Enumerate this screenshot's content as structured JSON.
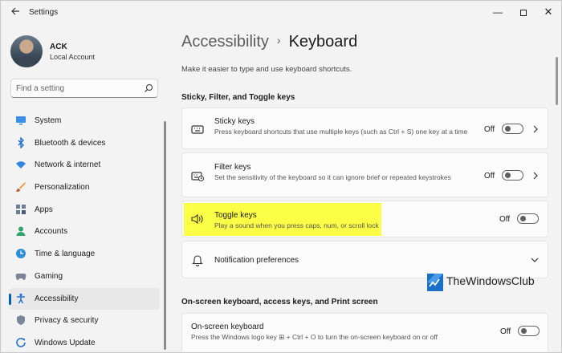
{
  "window": {
    "title": "Settings",
    "controls": {
      "minimize": "—",
      "close": "✕"
    }
  },
  "profile": {
    "name": "ACK",
    "account_type": "Local Account"
  },
  "search": {
    "placeholder": "Find a setting"
  },
  "sidebar": {
    "items": [
      {
        "label": "System",
        "icon": "monitor-icon",
        "active": false
      },
      {
        "label": "Bluetooth & devices",
        "icon": "bluetooth-icon",
        "active": false
      },
      {
        "label": "Network & internet",
        "icon": "wifi-icon",
        "active": false
      },
      {
        "label": "Personalization",
        "icon": "brush-icon",
        "active": false
      },
      {
        "label": "Apps",
        "icon": "apps-icon",
        "active": false
      },
      {
        "label": "Accounts",
        "icon": "person-icon",
        "active": false
      },
      {
        "label": "Time & language",
        "icon": "globe-clock-icon",
        "active": false
      },
      {
        "label": "Gaming",
        "icon": "gamepad-icon",
        "active": false
      },
      {
        "label": "Accessibility",
        "icon": "accessibility-icon",
        "active": true
      },
      {
        "label": "Privacy & security",
        "icon": "shield-icon",
        "active": false
      },
      {
        "label": "Windows Update",
        "icon": "update-icon",
        "active": false
      }
    ]
  },
  "breadcrumb": {
    "parent": "Accessibility",
    "separator": "›",
    "current": "Keyboard"
  },
  "page_description": "Make it easier to type and use keyboard shortcuts.",
  "sections": {
    "sticky_filter_toggle": {
      "title": "Sticky, Filter, and Toggle keys",
      "cards": {
        "sticky": {
          "title": "Sticky keys",
          "description": "Press keyboard shortcuts that use multiple keys (such as Ctrl + S) one key at a time",
          "state": "Off",
          "icon": "keyboard-icon"
        },
        "filter": {
          "title": "Filter keys",
          "description": "Set the sensitivity of the keyboard so it can ignore brief or repeated keystrokes",
          "state": "Off",
          "icon": "keyboard-timer-icon"
        },
        "toggle": {
          "title": "Toggle keys",
          "description": "Play a sound when you press caps, num, or scroll lock",
          "state": "Off",
          "icon": "speaker-icon",
          "highlight_color": "#fbff45"
        },
        "notification": {
          "title": "Notification preferences",
          "icon": "bell-icon"
        }
      }
    },
    "onscreen": {
      "title": "On-screen keyboard, access keys, and Print screen",
      "cards": {
        "osk": {
          "title": "On-screen keyboard",
          "description": "Press the Windows logo key ⊞ + Ctrl + O to turn the on-screen keyboard on or off",
          "state": "Off"
        }
      }
    }
  },
  "watermark": {
    "text": "TheWindowsClub"
  },
  "colors": {
    "accent": "#005fb8",
    "background": "#f3f3f3",
    "card": "#fbfbfb"
  }
}
